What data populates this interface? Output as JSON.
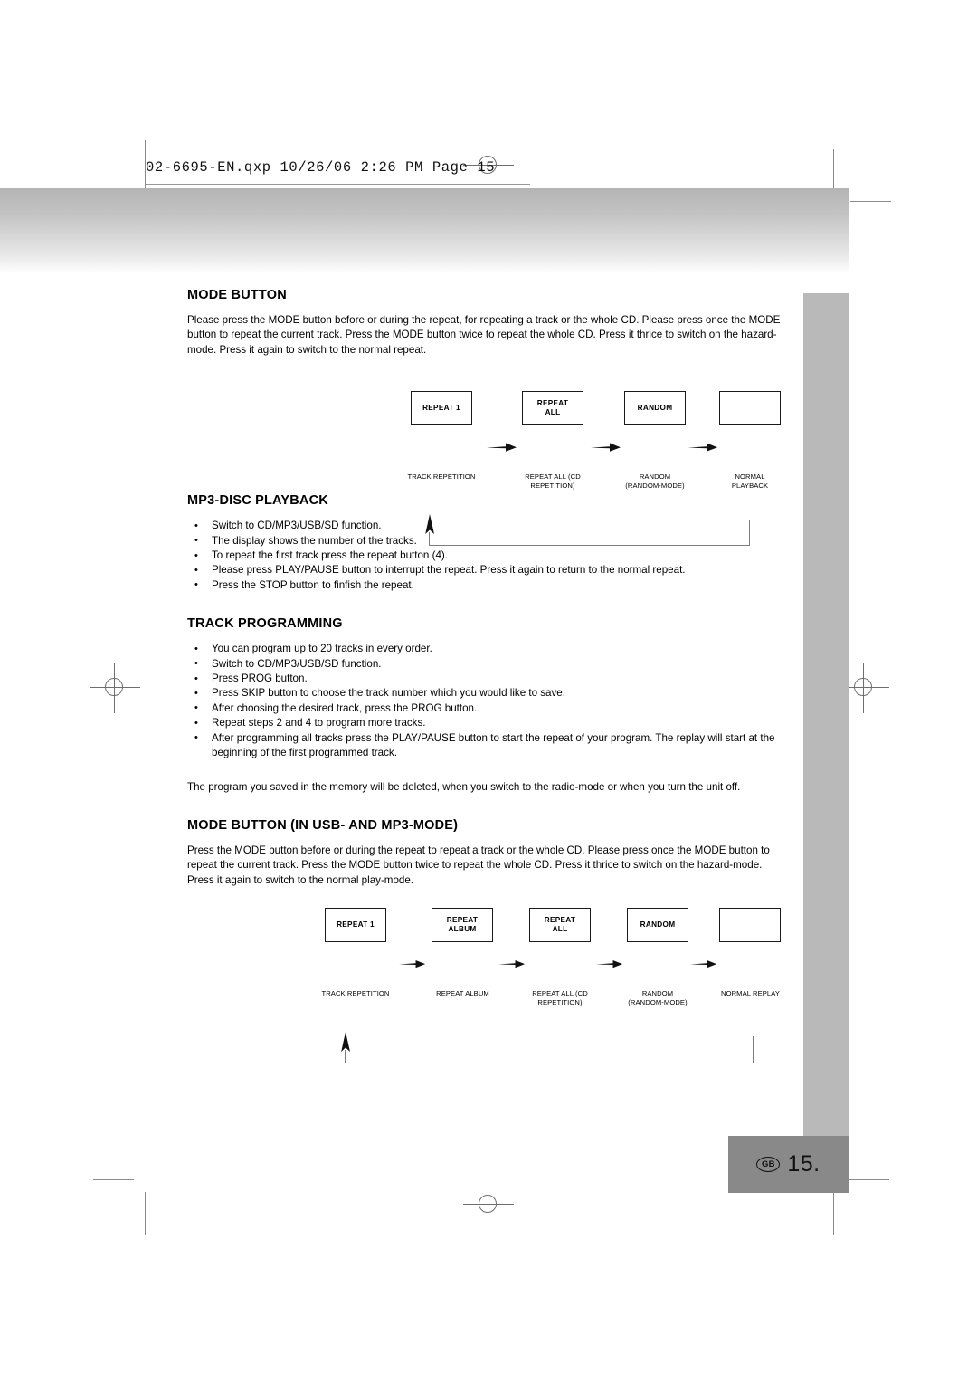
{
  "print_header": {
    "text": "02-6695-EN.qxp  10/26/06  2:26 PM  Page 15"
  },
  "footer": {
    "region_code": "GB",
    "page_number": "15."
  },
  "sections": [
    {
      "id": "mode-button",
      "title": "MODE BUTTON",
      "paragraph": "Please press the MODE button before or during the repeat, for repeating a track or the whole CD. Please press once the MODE button to repeat the current track. Press the MODE button twice to repeat the whole CD. Press it thrice to switch on the hazard-mode. Press it again to switch to the normal repeat."
    },
    {
      "id": "mp3-disc-playback",
      "title": "MP3-DISC PLAYBACK",
      "bullets": [
        "Switch to CD/MP3/USB/SD function.",
        "The display shows the number of the tracks.",
        "To repeat the first track press the repeat button (4).",
        "Please press PLAY/PAUSE button to interrupt the repeat. Press it again to return to the normal repeat.",
        "Press the STOP button to finfish the repeat."
      ]
    },
    {
      "id": "track-programming",
      "title": "TRACK PROGRAMMING",
      "bullets": [
        "You can program up to 20 tracks in every order.",
        "Switch to CD/MP3/USB/SD function.",
        "Press PROG button.",
        "Press SKIP button to choose the track number which you would like to save.",
        "After choosing the desired track, press the PROG button.",
        "Repeat steps 2 and 4 to program more tracks.",
        "After programming all tracks press the PLAY/PAUSE button to start the repeat of your program. The replay will start at the beginning of the first programmed track."
      ],
      "closing_paragraph": "The program you saved in the memory will be deleted, when you switch to the radio-mode or when you turn the unit off."
    },
    {
      "id": "mode-button-usb-mp3",
      "title": "MODE BUTTON (IN USB- AND MP3-MODE)",
      "paragraph": "Press the MODE button before or during the repeat to repeat a track or the whole CD. Please press once the MODE button to repeat the current track. Press the MODE button twice to repeat the whole CD. Press it thrice to switch on the hazard-mode. Press it again to switch to the normal play-mode."
    }
  ],
  "diagram_cd": {
    "steps": [
      {
        "box": "REPEAT 1",
        "label": "TRACK REPETITION"
      },
      {
        "box": "REPEAT\nALL",
        "label": "REPEAT ALL (CD\nREPETITION)"
      },
      {
        "box": "RANDOM",
        "label": "RANDOM\n(RANDOM-MODE)"
      },
      {
        "box": "",
        "label": "NORMAL\nPLAYBACK"
      }
    ],
    "loop_back": true
  },
  "diagram_usb_mp3": {
    "steps": [
      {
        "box": "REPEAT 1",
        "label": "TRACK REPETITION"
      },
      {
        "box": "REPEAT\nALBUM",
        "label": "REPEAT ALBUM"
      },
      {
        "box": "REPEAT\nALL",
        "label": "REPEAT ALL (CD\nREPETITION)"
      },
      {
        "box": "RANDOM",
        "label": "RANDOM\n(RANDOM-MODE)"
      },
      {
        "box": "",
        "label": "NORMAL REPLAY"
      }
    ],
    "loop_back": true
  },
  "colors": {
    "gray_column": "#b9b9b9",
    "page_badge": "#898989",
    "band_top": "#b4b4b4"
  }
}
